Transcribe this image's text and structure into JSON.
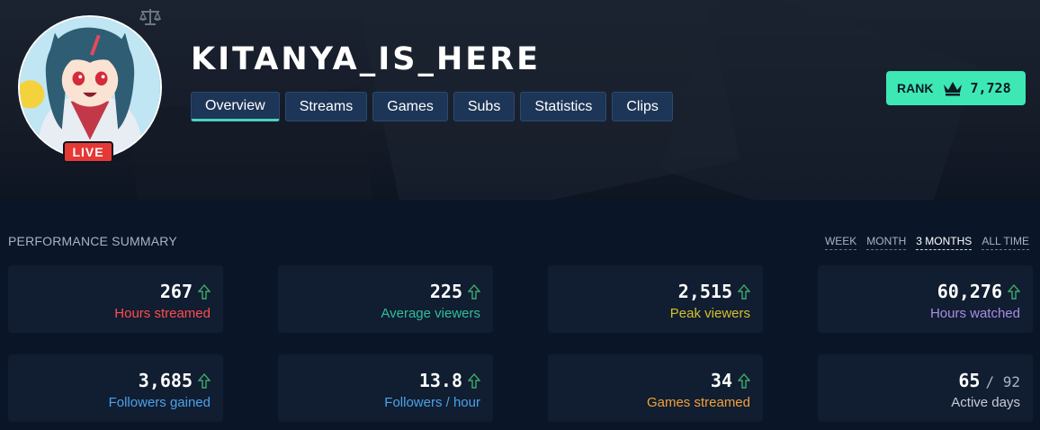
{
  "channel": {
    "name": "KITANYA_IS_HERE",
    "live_label": "LIVE",
    "avatar_icon": "anime-girl-avatar"
  },
  "tabs": [
    {
      "label": "Overview",
      "active": true
    },
    {
      "label": "Streams"
    },
    {
      "label": "Games"
    },
    {
      "label": "Subs"
    },
    {
      "label": "Statistics"
    },
    {
      "label": "Clips"
    }
  ],
  "rank": {
    "label": "RANK",
    "icon": "crown-icon",
    "value": "7,728"
  },
  "summary": {
    "title": "PERFORMANCE SUMMARY",
    "ranges": [
      "WEEK",
      "MONTH",
      "3 MONTHS",
      "ALL TIME"
    ],
    "active_range": "3 MONTHS"
  },
  "stats": [
    {
      "value": "267",
      "label": "Hours streamed",
      "color": "#ff4d4d",
      "trend": "up"
    },
    {
      "value": "225",
      "label": "Average viewers",
      "color": "#2fbf9a",
      "trend": "up"
    },
    {
      "value": "2,515",
      "label": "Peak viewers",
      "color": "#d4c12a",
      "trend": "up"
    },
    {
      "value": "60,276",
      "label": "Hours watched",
      "color": "#a98de0",
      "trend": "up"
    },
    {
      "value": "3,685",
      "label": "Followers gained",
      "color": "#4aa3e8",
      "trend": "up"
    },
    {
      "value": "13.8",
      "label": "Followers / hour",
      "color": "#4aa3e8",
      "trend": "up"
    },
    {
      "value": "34",
      "label": "Games streamed",
      "color": "#f0a23a",
      "trend": "up"
    },
    {
      "value": "65",
      "of": "/ 92",
      "label": "Active days",
      "color": "#c6ccd5"
    }
  ],
  "colors": {
    "accent": "#4ecdc4",
    "rank_bg": "#3de8b4",
    "live": "#e53935",
    "trend_up": "#3fa86b"
  }
}
